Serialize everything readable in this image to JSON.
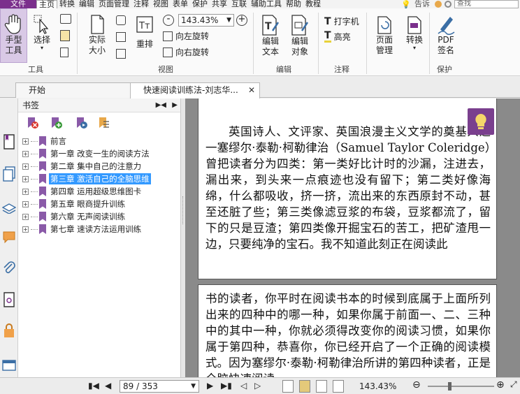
{
  "menubar": {
    "file": "文件",
    "items": [
      "主页",
      "转换",
      "编辑",
      "页面管理",
      "注释",
      "视图",
      "表单",
      "保护",
      "共享",
      "互联",
      "辅助工具",
      "帮助",
      "教程"
    ],
    "tell_me": "告诉",
    "search_placeholder": "查找"
  },
  "ribbon": {
    "hand_tool": [
      "手型",
      "工具"
    ],
    "select": "选择",
    "group_tools": "工具",
    "actual_size": [
      "实际",
      "大小"
    ],
    "reflow": "重排",
    "zoom_value": "143.43%",
    "rotate_left": "向左旋转",
    "rotate_right": "向右旋转",
    "group_view": "视图",
    "edit_text": [
      "编辑",
      "文本"
    ],
    "edit_object": [
      "编辑",
      "对象"
    ],
    "group_edit": "编辑",
    "typewriter": "打字机",
    "highlight": "高亮",
    "group_comment": "注释",
    "page_manage": [
      "页面",
      "管理"
    ],
    "convert": "转换",
    "pdf_sign": [
      "PDF",
      "签名"
    ],
    "group_protect": "保护"
  },
  "tabs": [
    {
      "label": "开始"
    },
    {
      "label": "快速阅读训练法-刘志华..."
    }
  ],
  "bookmarks": {
    "title": "书签",
    "items": [
      {
        "label": "前言"
      },
      {
        "label": "第一章 改变一生的阅读方法"
      },
      {
        "label": "第二章 集中自己的注意力"
      },
      {
        "label": "第三章 激活自己的全脑思维",
        "selected": true
      },
      {
        "label": "第四章 运用超级思维图卡"
      },
      {
        "label": "第五章 眼商提升训练"
      },
      {
        "label": "第六章 无声阅读训练"
      },
      {
        "label": "第七章 速读方法运用训练"
      }
    ]
  },
  "document": {
    "page1_text": "英国诗人、文评家、英国浪漫主义文学的奠基人之一塞缪尔·泰勒·柯勒律治（Samuel Taylor Coleridge）曾把读者分为四类：第一类好比计时的沙漏，注进去，漏出来，到头来一点痕迹也没有留下；第二类好像海绵，什么都吸收，挤一挤，流出来的东西原封不动，甚至还脏了些；第三类像滤豆浆的布袋，豆浆都流了，留下的只是豆渣；第四类像开掘宝石的苦工，把矿渣甩一边，只要纯净的宝石。我不知道此刻正在阅读此",
    "page2_text": "书的读者，你平时在阅读书本的时候到底属于上面所列出来的四种中的哪一种，如果你属于前面一、二、三种中的其中一种，你就必须得改变你的阅读习惯，如果你属于第四种，恭喜你，你已经开启了一个正确的阅读模式。因为塞缪尔·泰勒·柯勒律治所讲的第四种读者，正是全脑快速阅读"
  },
  "statusbar": {
    "page_value": "89 / 353",
    "zoom": "143.43%",
    "zoom_fraction": 0.32
  },
  "colors": {
    "accent": "#7b2f8c",
    "selection": "#3399ff"
  }
}
